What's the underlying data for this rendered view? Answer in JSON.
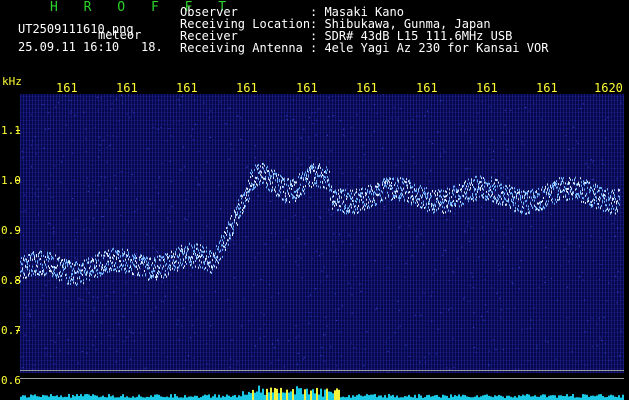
{
  "header": {
    "brand": "H R O F F T",
    "filename": "UT2509111610.png",
    "tag": "meteor",
    "datetime": "25.09.11 16:10",
    "speed": "18.",
    "labels": {
      "observer": "Observer",
      "location": "Receiving Location",
      "receiver": "Receiver",
      "antenna": "Receiving Antenna"
    },
    "values": {
      "observer": ": Masaki Kano",
      "location": ": Shibukawa, Gunma, Japan",
      "receiver": ": SDR# 43dB L15 111.6MHz USB",
      "antenna": ": 4ele Yagi Az 230 for Kansai VOR"
    }
  },
  "colors": {
    "background": "#000000",
    "label": "#ffff33",
    "brand": "#2bd32b",
    "signal": "#6fb3ff",
    "noise": "#08084a"
  },
  "axes": {
    "unit": "kHz",
    "x_ticks": [
      "161",
      "161",
      "161",
      "161",
      "161",
      "161",
      "161",
      "161",
      "161",
      "1620"
    ],
    "y_ticks": [
      "1.1",
      "1.0",
      "0.9",
      "0.8",
      "0.7",
      "0.6"
    ]
  }
}
